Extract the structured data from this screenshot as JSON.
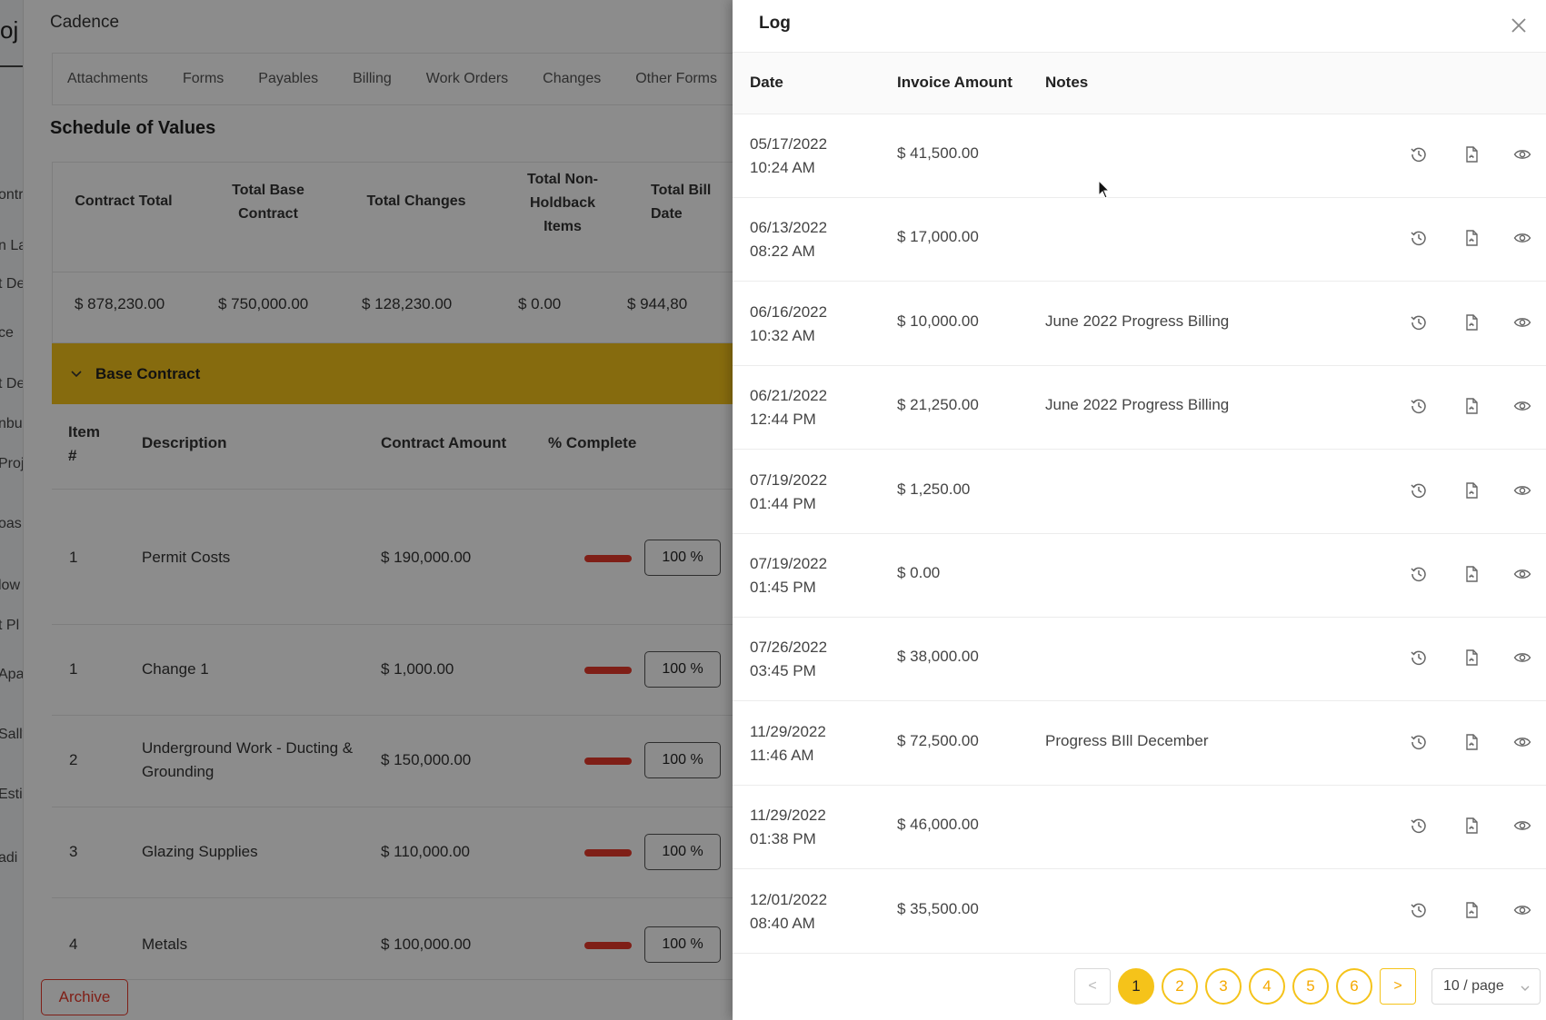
{
  "sidebar": {
    "fragments": [
      "oj",
      "ontr",
      "n La",
      "t De",
      "ce",
      "t De",
      "nbu",
      "Proj",
      "oas",
      "low",
      "t Pl",
      "Apa",
      "Sally",
      "Esti",
      "adi"
    ]
  },
  "app": {
    "title": "Cadence"
  },
  "tabs": [
    "Attachments",
    "Forms",
    "Payables",
    "Billing",
    "Work Orders",
    "Changes",
    "Other Forms"
  ],
  "schedule": {
    "title": "Schedule of Values",
    "headers": [
      "Contract Total",
      "Total Base\nContract",
      "Total Changes",
      "Total Non-\nHoldback\nItems",
      "Total Bill\nDate"
    ],
    "values": [
      "$ 878,230.00",
      "$ 750,000.00",
      "$ 128,230.00",
      "$ 0.00",
      "$ 944,80"
    ]
  },
  "section": {
    "label": "Base Contract",
    "color": "#f5c31a"
  },
  "items": {
    "headers": {
      "item": "Item\n#",
      "description": "Description",
      "amount": "Contract Amount",
      "complete": "% Complete"
    },
    "rows": [
      {
        "item": "1",
        "description": "Permit Costs",
        "amount": "$ 190,000.00",
        "pct": "100 %",
        "complete_fraction": 1.0
      },
      {
        "item": "1",
        "description": "Change 1",
        "amount": "$ 1,000.00",
        "pct": "100 %",
        "complete_fraction": 1.0
      },
      {
        "item": "2",
        "description": "Underground Work - Ducting & Grounding",
        "amount": "$ 150,000.00",
        "pct": "100 %",
        "complete_fraction": 1.0
      },
      {
        "item": "3",
        "description": "Glazing Supplies",
        "amount": "$ 110,000.00",
        "pct": "100 %",
        "complete_fraction": 1.0
      },
      {
        "item": "4",
        "description": "Metals",
        "amount": "$ 100,000.00",
        "pct": "100 %",
        "complete_fraction": 1.0
      }
    ]
  },
  "archive_label": "Archive",
  "drawer": {
    "title": "Log",
    "columns": {
      "date": "Date",
      "amount": "Invoice Amount",
      "notes": "Notes"
    },
    "rows": [
      {
        "date": "05/17/2022",
        "time": "10:24 AM",
        "amount": "$ 41,500.00",
        "notes": ""
      },
      {
        "date": "06/13/2022",
        "time": "08:22 AM",
        "amount": "$ 17,000.00",
        "notes": ""
      },
      {
        "date": "06/16/2022",
        "time": "10:32 AM",
        "amount": "$ 10,000.00",
        "notes": "June 2022 Progress Billing"
      },
      {
        "date": "06/21/2022",
        "time": "12:44 PM",
        "amount": "$ 21,250.00",
        "notes": "June 2022 Progress Billing"
      },
      {
        "date": "07/19/2022",
        "time": "01:44 PM",
        "amount": "$ 1,250.00",
        "notes": ""
      },
      {
        "date": "07/19/2022",
        "time": "01:45 PM",
        "amount": "$ 0.00",
        "notes": ""
      },
      {
        "date": "07/26/2022",
        "time": "03:45 PM",
        "amount": "$ 38,000.00",
        "notes": ""
      },
      {
        "date": "11/29/2022",
        "time": "11:46 AM",
        "amount": "$ 72,500.00",
        "notes": "Progress BIll December"
      },
      {
        "date": "11/29/2022",
        "time": "01:38 PM",
        "amount": "$ 46,000.00",
        "notes": ""
      },
      {
        "date": "12/01/2022",
        "time": "08:40 AM",
        "amount": "$ 35,500.00",
        "notes": ""
      }
    ],
    "row_icons": [
      "history-icon",
      "pdf-icon",
      "eye-icon"
    ],
    "pagination": {
      "pages": [
        "1",
        "2",
        "3",
        "4",
        "5",
        "6"
      ],
      "current": "1",
      "page_size": "10 / page",
      "prev": "<",
      "next": ">"
    }
  },
  "colors": {
    "accent": "#f5c31a",
    "danger": "#e8392b"
  }
}
